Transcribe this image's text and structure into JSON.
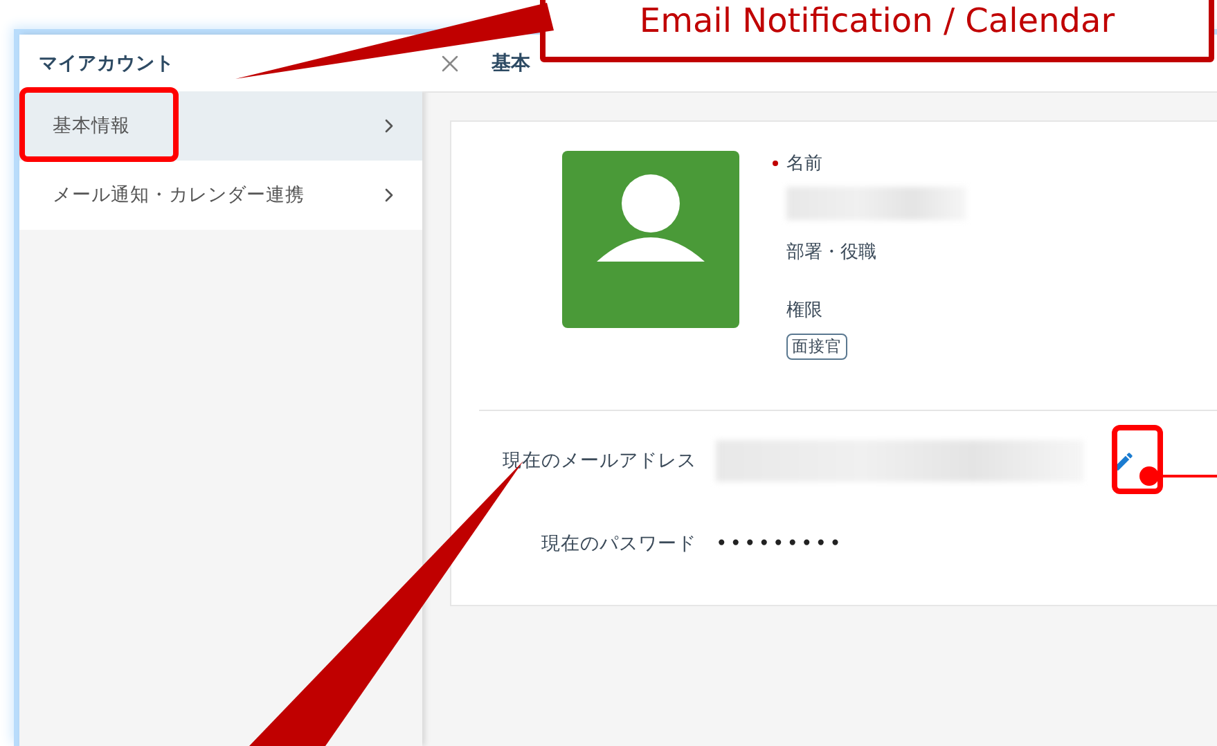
{
  "sidebar": {
    "title": "マイアカウント",
    "items": [
      {
        "label": "基本情報",
        "selected": true
      },
      {
        "label": "メール通知・カレンダー連携",
        "selected": false
      }
    ]
  },
  "panel": {
    "title": "基本",
    "fields": [
      {
        "label": "名前",
        "required": true
      },
      {
        "label": "部署・役職",
        "required": false
      },
      {
        "label": "権限",
        "required": false
      }
    ],
    "role_tag": "面接官",
    "account": [
      {
        "kind": "email",
        "label": "現在のメールアドレス"
      },
      {
        "kind": "password",
        "label": "現在のパスワード",
        "value": "•••••••••"
      }
    ]
  },
  "callout": {
    "text": "Email Notification / Calendar"
  }
}
